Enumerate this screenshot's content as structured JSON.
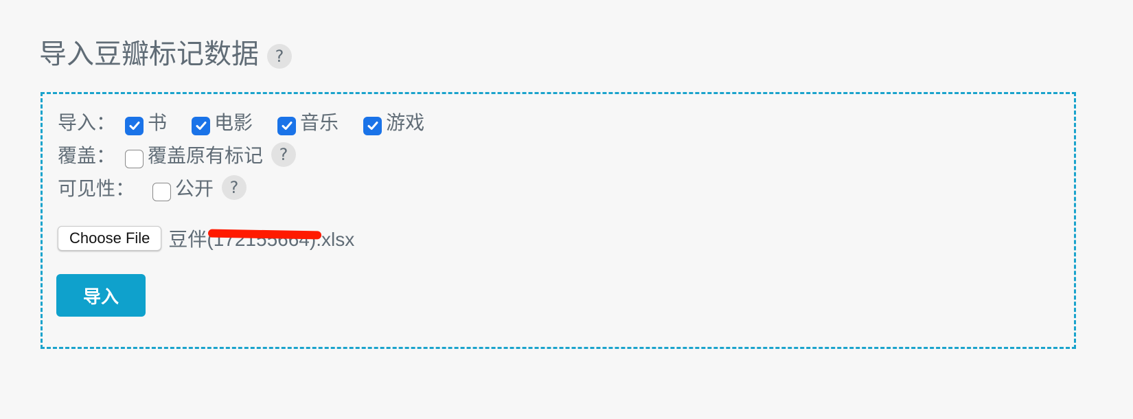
{
  "header": {
    "title": "导入豆瓣标记数据",
    "help_glyph": "?"
  },
  "form": {
    "types": {
      "label": "导入：",
      "options": [
        {
          "label": "书",
          "checked": true
        },
        {
          "label": "电影",
          "checked": true
        },
        {
          "label": "音乐",
          "checked": true
        },
        {
          "label": "游戏",
          "checked": true
        }
      ]
    },
    "overwrite": {
      "label": "覆盖：",
      "option_label": "覆盖原有标记",
      "checked": false,
      "help_glyph": "?"
    },
    "visibility": {
      "label": "可见性：",
      "option_label": "公开",
      "checked": false,
      "help_glyph": "?"
    },
    "file": {
      "button_label": "Choose File",
      "file_name": "豆伴(172155664).xlsx"
    },
    "submit_label": "导入"
  },
  "colors": {
    "accent": "#0fa1cc",
    "border": "#1aa3cc",
    "checkbox_checked": "#1a73e8",
    "text": "#606c76",
    "redaction": "#ff1a00",
    "background": "#f7f7f7"
  },
  "icons": {
    "help": "question-mark-circle-icon",
    "check": "checkmark-icon"
  }
}
